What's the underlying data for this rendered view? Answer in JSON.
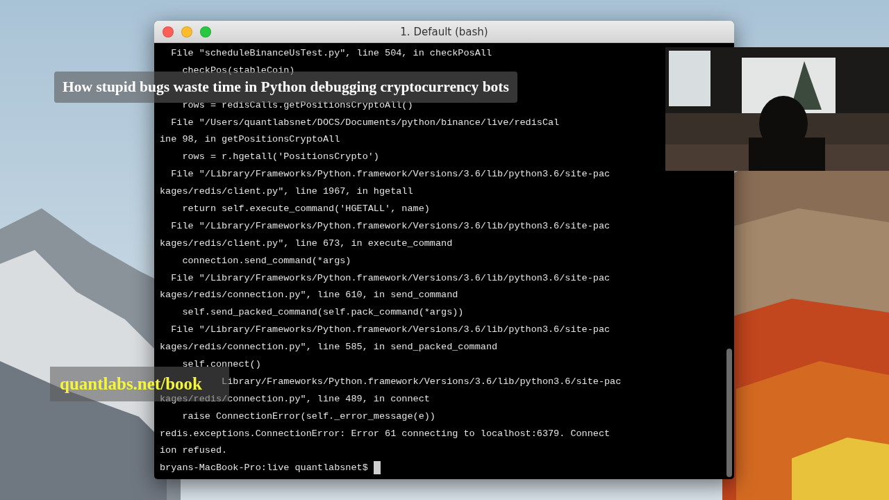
{
  "window": {
    "title": "1. Default (bash)",
    "lines": [
      {
        "kind": "text",
        "text": "  File \"scheduleBinanceUsTest.py\", line 504, in checkPosAll"
      },
      {
        "kind": "text",
        "text": "    checkPos(stableCoin)"
      },
      {
        "kind": "hidden"
      },
      {
        "kind": "text",
        "text": "    rows = redisCalls.getPositionsCryptoAll()"
      },
      {
        "kind": "text",
        "text": "  File \"/Users/quantlabsnet/DOCS/Documents/python/binance/live/redisCal"
      },
      {
        "kind": "text",
        "text": "ine 98, in getPositionsCryptoAll"
      },
      {
        "kind": "text",
        "text": "    rows = r.hgetall('PositionsCrypto')"
      },
      {
        "kind": "text",
        "text": "  File \"/Library/Frameworks/Python.framework/Versions/3.6/lib/python3.6/site-pac"
      },
      {
        "kind": "text",
        "text": "kages/redis/client.py\", line 1967, in hgetall"
      },
      {
        "kind": "text",
        "text": "    return self.execute_command('HGETALL', name)"
      },
      {
        "kind": "text",
        "text": "  File \"/Library/Frameworks/Python.framework/Versions/3.6/lib/python3.6/site-pac"
      },
      {
        "kind": "text",
        "text": "kages/redis/client.py\", line 673, in execute_command"
      },
      {
        "kind": "text",
        "text": "    connection.send_command(*args)"
      },
      {
        "kind": "text",
        "text": "  File \"/Library/Frameworks/Python.framework/Versions/3.6/lib/python3.6/site-pac"
      },
      {
        "kind": "text",
        "text": "kages/redis/connection.py\", line 610, in send_command"
      },
      {
        "kind": "text",
        "text": "    self.send_packed_command(self.pack_command(*args))"
      },
      {
        "kind": "text",
        "text": "  File \"/Library/Frameworks/Python.framework/Versions/3.6/lib/python3.6/site-pac"
      },
      {
        "kind": "text",
        "text": "kages/redis/connection.py\", line 585, in send_packed_command"
      },
      {
        "kind": "text",
        "text": "    self.connect()"
      },
      {
        "kind": "text",
        "text": "           Library/Frameworks/Python.framework/Versions/3.6/lib/python3.6/site-pac"
      },
      {
        "kind": "text",
        "text": "kages/redis/connection.py\", line 489, in connect"
      },
      {
        "kind": "text",
        "text": "    raise ConnectionError(self._error_message(e))"
      },
      {
        "kind": "text",
        "text": "redis.exceptions.ConnectionError: Error 61 connecting to localhost:6379. Connect"
      },
      {
        "kind": "text",
        "text": "ion refused."
      }
    ],
    "prompt": "bryans-MacBook-Pro:live quantlabsnet$"
  },
  "overlays": {
    "title_caption": "How stupid bugs waste time in Python debugging cryptocurrency bots",
    "link_caption": "quantlabs.net/book"
  }
}
